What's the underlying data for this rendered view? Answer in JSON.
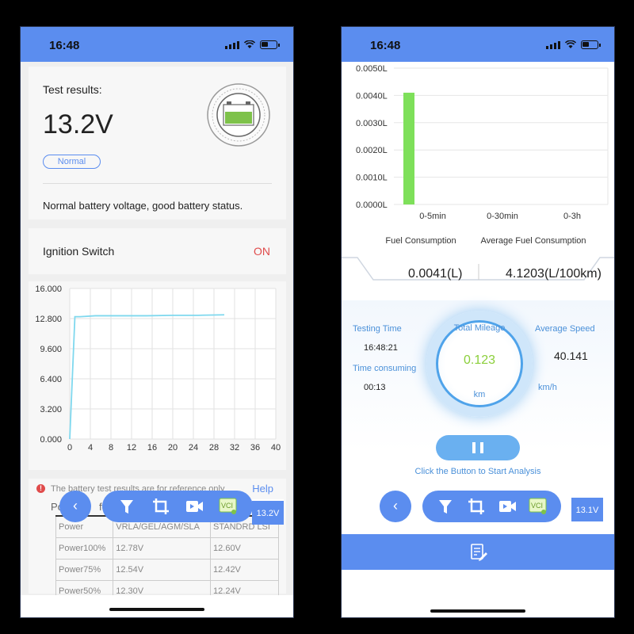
{
  "left": {
    "status_time": "16:48",
    "results": {
      "label": "Test results:",
      "voltage": "13.2V",
      "badge": "Normal",
      "description": "Normal battery voltage, good battery status."
    },
    "ignition": {
      "label": "Ignition Switch",
      "value": "ON"
    },
    "notice": {
      "text": "The battery test results are for reference only",
      "help": "Help",
      "row_label": "Po",
      "row_label_tail": "fer",
      "table": [
        [
          "Power",
          "VRLA/GEL/AGM/SLA",
          "STANDRD LSI"
        ],
        [
          "Power100%",
          "12.78V",
          "12.60V"
        ],
        [
          "Power75%",
          "12.54V",
          "12.42V"
        ],
        [
          "Power50%",
          "12.30V",
          "12.24V"
        ]
      ]
    },
    "volt_chip": "13.2V",
    "tool_vci": "VCI"
  },
  "chart_data": [
    {
      "type": "line",
      "title": "",
      "xlabel": "",
      "ylabel": "",
      "x_ticks": [
        "0",
        "4",
        "8",
        "12",
        "16",
        "20",
        "24",
        "28",
        "32",
        "36",
        "40"
      ],
      "y_ticks": [
        "0.000",
        "3.200",
        "6.400",
        "9.600",
        "12.800",
        "16.000"
      ],
      "xlim": [
        0,
        40
      ],
      "ylim": [
        0,
        16
      ],
      "grid": true,
      "series": [
        {
          "color": "#7fd8ee",
          "x": [
            0,
            1,
            2,
            5,
            10,
            15,
            20,
            25,
            30
          ],
          "y": [
            0,
            13.0,
            13.0,
            13.1,
            13.1,
            13.1,
            13.15,
            13.15,
            13.2
          ]
        }
      ]
    },
    {
      "type": "bar",
      "title": "",
      "categories": [
        "0-5min",
        "0-30min",
        "0-3h"
      ],
      "values": [
        0.0041,
        0,
        0
      ],
      "y_ticks": [
        "0.0000L",
        "0.0010L",
        "0.0020L",
        "0.0030L",
        "0.0040L",
        "0.0050L"
      ],
      "ylim": [
        0,
        0.005
      ],
      "bar_color": "#7ee05a",
      "grid": true
    }
  ],
  "right": {
    "status_time": "16:48",
    "fuel_label": "Fuel Consumption",
    "avg_fuel_label": "Average Fuel Consumption",
    "fuel_value": "0.0041(L)",
    "avg_fuel_value": "4.1203(L/100km)",
    "testing_time_label": "Testing Time",
    "testing_time": "16:48:21",
    "time_consuming_label": "Time consuming",
    "time_consuming": "00:13",
    "total_mileage_label": "Total Mileage",
    "total_mileage": "0.123",
    "mileage_unit": "km",
    "avg_speed_label": "Average Speed",
    "avg_speed": "40.141",
    "speed_unit": "km/h",
    "hint": "Click the Button to Start Analysis",
    "volt_chip": "13.1V",
    "tool_vci": "VCI"
  },
  "colors": {
    "brand": "#5b8def",
    "on": "#e04b4b",
    "accent_green": "#7ee05a",
    "line": "#7fd8ee"
  }
}
